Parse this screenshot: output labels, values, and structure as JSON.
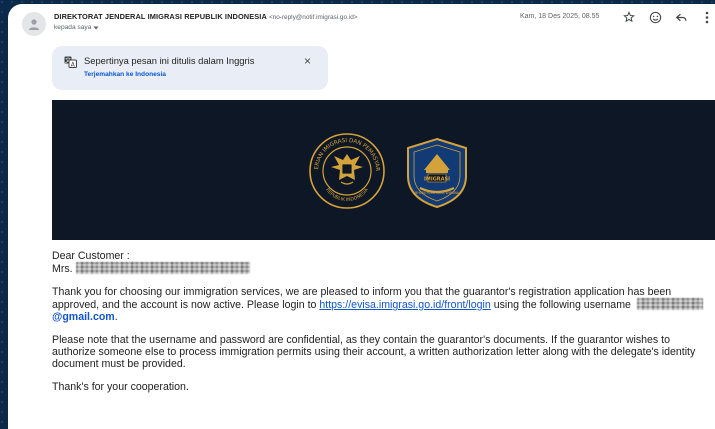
{
  "header": {
    "sender_name": "DIREKTORAT JENDERAL IMIGRASI REPUBLIK INDONESIA",
    "sender_email": "<no-reply@notif.imigrasi.go.id>",
    "recipient": "kepada saya",
    "date": "Kam, 18 Des 2025, 08.55",
    "icons": [
      "star-icon",
      "emoji-icon",
      "reply-icon",
      "more-icon"
    ]
  },
  "translate_banner": {
    "title": "Sepertinya pesan ini ditulis dalam Inggris",
    "action": "Terjemahkan ke Indonesia",
    "close": "×"
  },
  "email": {
    "greeting": "Dear Customer :",
    "name_prefix": "Mrs.",
    "p1_part1": "Thank you for choosing our immigration services, we are pleased to inform you that the guarantor's registration application has been approved, and the account is now active. Please login to",
    "login_link": "https://evisa.imigrasi.go.id/front/login",
    "p1_part2": "using the following username",
    "email_domain": "@gmail.com",
    "p1_end": ".",
    "p2": "Please note that the username and password are confidential, as they contain the guarantor's documents. If the guarantor wishes to authorize someone else to process immigration permits using their account, a written authorization letter along with the delegate's identity document must be provided.",
    "p3": "Thank's for your cooperation."
  },
  "seals": {
    "left_text_top": "KEMENTERIAN IMIGRASI DAN PEMASYARAKATAN",
    "left_text_bottom": "REPUBLIK INDONESIA",
    "right_label": "IMIGRASI",
    "right_motto": "BHUMI PURA WIRA WIBAWA"
  },
  "colors": {
    "page_bg": "#0b2a4a",
    "banner_bg": "#0e1726",
    "gold": "#d4a23a",
    "link": "#1155cc",
    "translate_bg": "#e9eef6"
  }
}
